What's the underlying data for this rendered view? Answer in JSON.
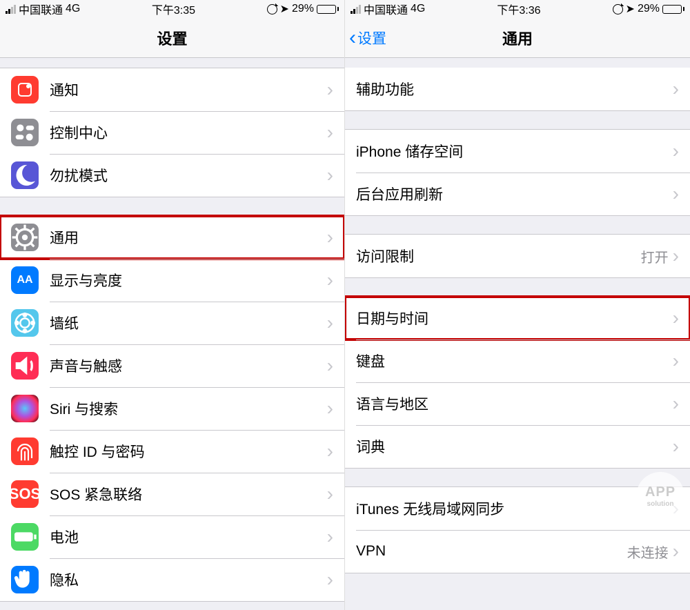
{
  "left": {
    "status": {
      "carrier": "中国联通",
      "net": "4G",
      "time": "下午3:35",
      "battery_pct": "29%"
    },
    "title": "设置",
    "groups": [
      {
        "rows": [
          {
            "id": "notifications",
            "label": "通知"
          },
          {
            "id": "control-center",
            "label": "控制中心"
          },
          {
            "id": "do-not-disturb",
            "label": "勿扰模式"
          }
        ]
      },
      {
        "rows": [
          {
            "id": "general",
            "label": "通用",
            "highlight": true
          },
          {
            "id": "display",
            "label": "显示与亮度"
          },
          {
            "id": "wallpaper",
            "label": "墙纸"
          },
          {
            "id": "sounds",
            "label": "声音与触感"
          },
          {
            "id": "siri",
            "label": "Siri 与搜索"
          },
          {
            "id": "touchid",
            "label": "触控 ID 与密码"
          },
          {
            "id": "sos",
            "label": "SOS 紧急联络"
          },
          {
            "id": "battery",
            "label": "电池"
          },
          {
            "id": "privacy",
            "label": "隐私"
          }
        ]
      }
    ]
  },
  "right": {
    "status": {
      "carrier": "中国联通",
      "net": "4G",
      "time": "下午3:36",
      "battery_pct": "29%"
    },
    "back": "设置",
    "title": "通用",
    "groups": [
      {
        "rows": [
          {
            "id": "accessibility",
            "label": "辅助功能"
          }
        ]
      },
      {
        "rows": [
          {
            "id": "storage",
            "label": "iPhone 储存空间"
          },
          {
            "id": "bg-refresh",
            "label": "后台应用刷新"
          }
        ]
      },
      {
        "rows": [
          {
            "id": "restrictions",
            "label": "访问限制",
            "detail": "打开"
          }
        ]
      },
      {
        "rows": [
          {
            "id": "date-time",
            "label": "日期与时间",
            "highlight": true
          },
          {
            "id": "keyboard",
            "label": "键盘"
          },
          {
            "id": "lang-region",
            "label": "语言与地区"
          },
          {
            "id": "dictionary",
            "label": "词典"
          }
        ]
      },
      {
        "rows": [
          {
            "id": "itunes-wifi-sync",
            "label": "iTunes 无线局域网同步"
          },
          {
            "id": "vpn",
            "label": "VPN",
            "detail": "未连接"
          }
        ]
      }
    ]
  },
  "watermark": {
    "l1": "APP",
    "l2": "solution"
  }
}
